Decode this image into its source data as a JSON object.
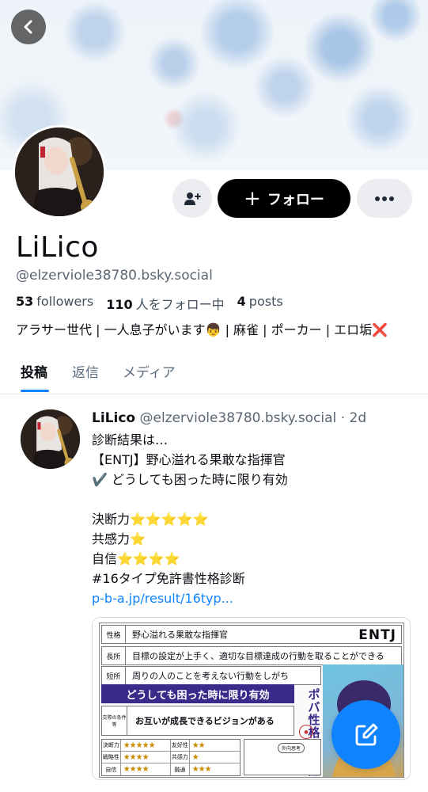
{
  "profile": {
    "display_name": "LiLico",
    "handle": "@elzerviole38780.bsky.social",
    "followers_count": "53",
    "followers_label": "followers",
    "following_count": "110",
    "following_label": "人をフォロー中",
    "posts_count": "4",
    "posts_label": "posts",
    "bio": "アラサー世代 | 一人息子がいます👦 | 麻雀 | ポーカー | エロ垢❌"
  },
  "actions": {
    "follow_label": "フォロー",
    "follow_plus": "+"
  },
  "tabs": [
    {
      "label": "投稿",
      "active": true
    },
    {
      "label": "返信",
      "active": false
    },
    {
      "label": "メディア",
      "active": false
    }
  ],
  "post": {
    "author_name": "LiLico",
    "author_handle": "@elzerviole38780.bsky.social",
    "time": "· 2d",
    "lines": [
      "診断結果は…",
      "【ENTJ】野心溢れる果敢な指揮官",
      "✔️ どうしても困った時に限り有効",
      "",
      "決断力⭐⭐⭐⭐⭐",
      "共感力⭐",
      "自信⭐⭐⭐⭐",
      "#16タイプ免許書性格診断"
    ],
    "link": "p-b-a.jp/result/16typ..."
  },
  "card": {
    "row1_key": "性格",
    "row1_val": "野心溢れる果敢な指揮官",
    "type": "ENTJ",
    "row2_key": "長所",
    "row2_val": "目標の設定が上手く、適切な目標達成の行動を取ることができる",
    "row3_key": "短所",
    "row3_val": "周りの人のことを考えない行動をしがち",
    "banner": "どうしても困った時に限り有効",
    "vision_key": "交際の条件等",
    "vision_val": "お互いが成長できるビジョンがある",
    "vertical_title": "ポバ性格免許証",
    "traits": [
      {
        "a": "決断力",
        "as": "★★★★★",
        "b": "友好性",
        "bs": "★★"
      },
      {
        "a": "戦略性",
        "as": "★★★★",
        "b": "共感力",
        "bs": "★"
      },
      {
        "a": "自信",
        "as": "★★★★",
        "b": "融通",
        "bs": "★★★"
      }
    ],
    "chip": "外向思考"
  },
  "colors": {
    "accent": "#1083fe",
    "follow_bg": "#000000",
    "secondary_btn_bg": "#ecedf0",
    "muted_text": "#5a6572"
  }
}
